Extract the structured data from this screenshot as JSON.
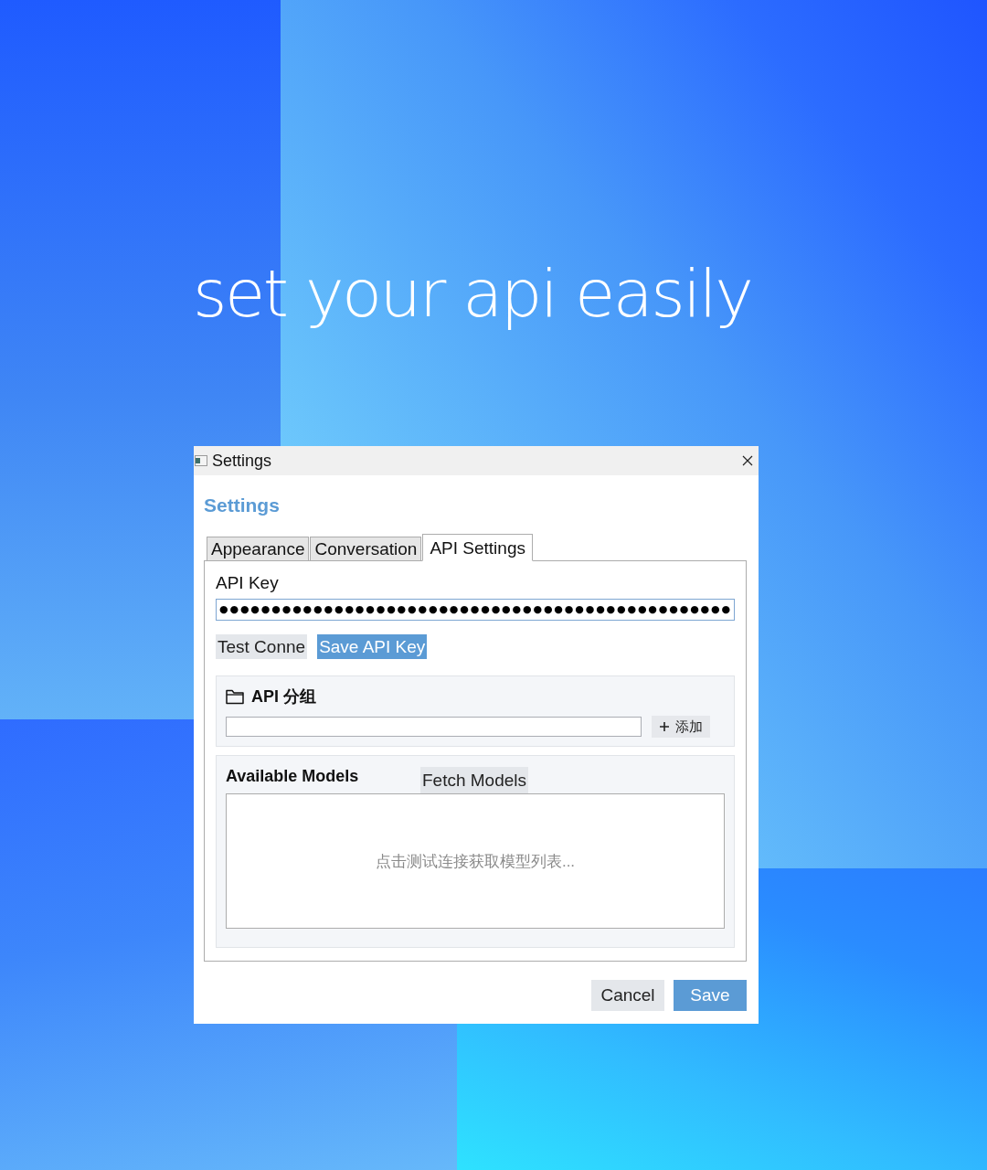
{
  "headline": "set your api easily",
  "window": {
    "title": "Settings"
  },
  "heading": "Settings",
  "tabs": [
    {
      "label": "Appearance",
      "selected": false
    },
    {
      "label": "Conversation",
      "selected": false
    },
    {
      "label": "API Settings",
      "selected": true
    }
  ],
  "api_key": {
    "label": "API Key",
    "value": "●●●●●●●●●●●●●●●●●●●●●●●●●●●●●●●●●●●●●●●●●●●●●●●●●"
  },
  "key_actions": [
    {
      "label": "Test Conne",
      "kind": "secondary"
    },
    {
      "label": "Save API Key",
      "kind": "primary"
    }
  ],
  "api_groups": {
    "title": "API 分组",
    "add_button": {
      "label": "添加"
    }
  },
  "models": {
    "title": "Available Models",
    "fetch_button": {
      "label": "Fetch Models"
    },
    "empty_text": "点击测试连接获取模型列表..."
  },
  "footer_buttons": [
    {
      "label": "Cancel",
      "kind": "secondary"
    },
    {
      "label": "Save",
      "kind": "primary"
    }
  ]
}
